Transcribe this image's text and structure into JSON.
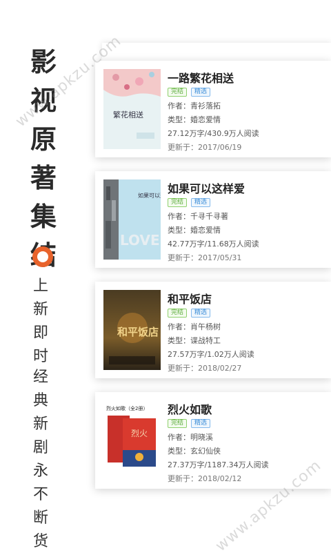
{
  "promo": {
    "title_chars": [
      "影",
      "视",
      "原",
      "著",
      "集",
      "结"
    ],
    "col1_chars": [
      "上",
      "新",
      "即",
      "时"
    ],
    "col2_chars": [
      "经",
      "典",
      "新",
      "剧",
      "永",
      "不",
      "断",
      "货"
    ],
    "accent_color": "#e8632c"
  },
  "watermark": "www.apkzu.com",
  "books": [
    {
      "title": "一路繁花相送",
      "tags": [
        "完结",
        "精选"
      ],
      "author": "作者：青衫落拓",
      "genre": "类型：婚恋爱情",
      "stats": "27.12万字/430.9万人阅读",
      "updated": "更新于：2017/06/19",
      "cover_text": "繁花相送"
    },
    {
      "title": "如果可以这样爱",
      "tags": [
        "完结",
        "精选"
      ],
      "author": "作者：千寻千寻著",
      "genre": "类型：婚恋爱情",
      "stats": "42.77万字/11.68万人阅读",
      "updated": "更新于：2017/05/31",
      "cover_text": "如果可以这样爱"
    },
    {
      "title": "和平饭店",
      "tags": [
        "完结",
        "精选"
      ],
      "author": "作者：肖午杨树",
      "genre": "类型：谍战特工",
      "stats": "27.57万字/1.02万人阅读",
      "updated": "更新于：2018/02/27",
      "cover_text": "和平饭店"
    },
    {
      "title": "烈火如歌",
      "tags": [
        "完结",
        "精选"
      ],
      "author": "作者：明晓溪",
      "genre": "类型：玄幻仙侠",
      "stats": "27.37万字/1187.34万人阅读",
      "updated": "更新于：2018/02/12",
      "cover_text": "烈火如歌（全2册）"
    }
  ]
}
